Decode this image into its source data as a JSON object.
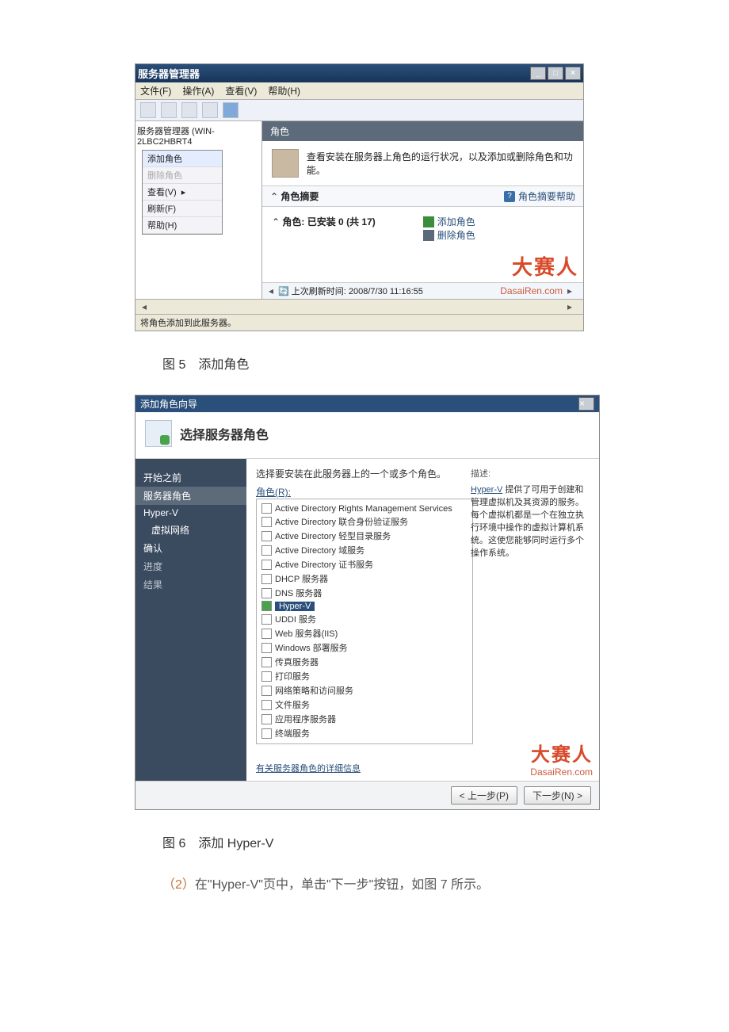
{
  "s1": {
    "title": "服务器管理器",
    "menu": {
      "file": "文件(F)",
      "action": "操作(A)",
      "view": "查看(V)",
      "help2": "帮助(H)"
    },
    "tree": {
      "root": "服务器管理器 (WIN-2LBC2HBRT4",
      "ctx": {
        "add_role": "添加角色",
        "del_role": "删除角色",
        "view": "查看(V)",
        "refresh": "刷新(F)",
        "help": "帮助(H)"
      }
    },
    "content": {
      "header": "角色",
      "banner": "查看安装在服务器上角色的运行状况，以及添加或删除角色和功能。",
      "summary": "角色摘要",
      "summary_help": "角色摘要帮助",
      "installed": "角色: 已安装 0 (共 17)",
      "add_link": "添加角色",
      "del_link": "删除角色",
      "refresh_time": "上次刷新时间: 2008/7/30 11:16:55"
    },
    "status": "将角色添加到此服务器。",
    "wmk": {
      "title": "大赛人",
      "sub": "DasaiRen.com"
    }
  },
  "caption1": "图 5　添加角色",
  "s2": {
    "title": "添加角色向导",
    "header": "选择服务器角色",
    "nav": {
      "before": "开始之前",
      "roles": "服务器角色",
      "hyperv": "Hyper-V",
      "vnet": "虚拟网络",
      "confirm": "确认",
      "progress": "进度",
      "result": "结果"
    },
    "prompt": "选择要安装在此服务器上的一个或多个角色。",
    "list_label": "角色(R):",
    "roles": [
      "Active Directory Rights Management Services",
      "Active Directory 联合身份验证服务",
      "Active Directory 轻型目录服务",
      "Active Directory 域服务",
      "Active Directory 证书服务",
      "DHCP 服务器",
      "DNS 服务器",
      "Hyper-V",
      "UDDI 服务",
      "Web 服务器(IIS)",
      "Windows 部署服务",
      "传真服务器",
      "打印服务",
      "网络策略和访问服务",
      "文件服务",
      "应用程序服务器",
      "终端服务"
    ],
    "desc_h": "描述:",
    "desc_link": "Hyper-V",
    "desc_txt": " 提供了可用于创建和管理虚拟机及其资源的服务。每个虚拟机都是一个在独立执行环境中操作的虚拟计算机系统。这使您能够同时运行多个操作系统。",
    "more": "有关服务器角色的详细信息",
    "btn_prev": "< 上一步(P)",
    "btn_next": "下一步(N) >",
    "wmk": {
      "title": "大赛人",
      "sub": "DasaiRen.com"
    }
  },
  "caption2": "图 6　添加 Hyper-V",
  "step2": "（2）在\"Hyper-V\"页中，单击\"下一步\"按钮，如图 7 所示。"
}
